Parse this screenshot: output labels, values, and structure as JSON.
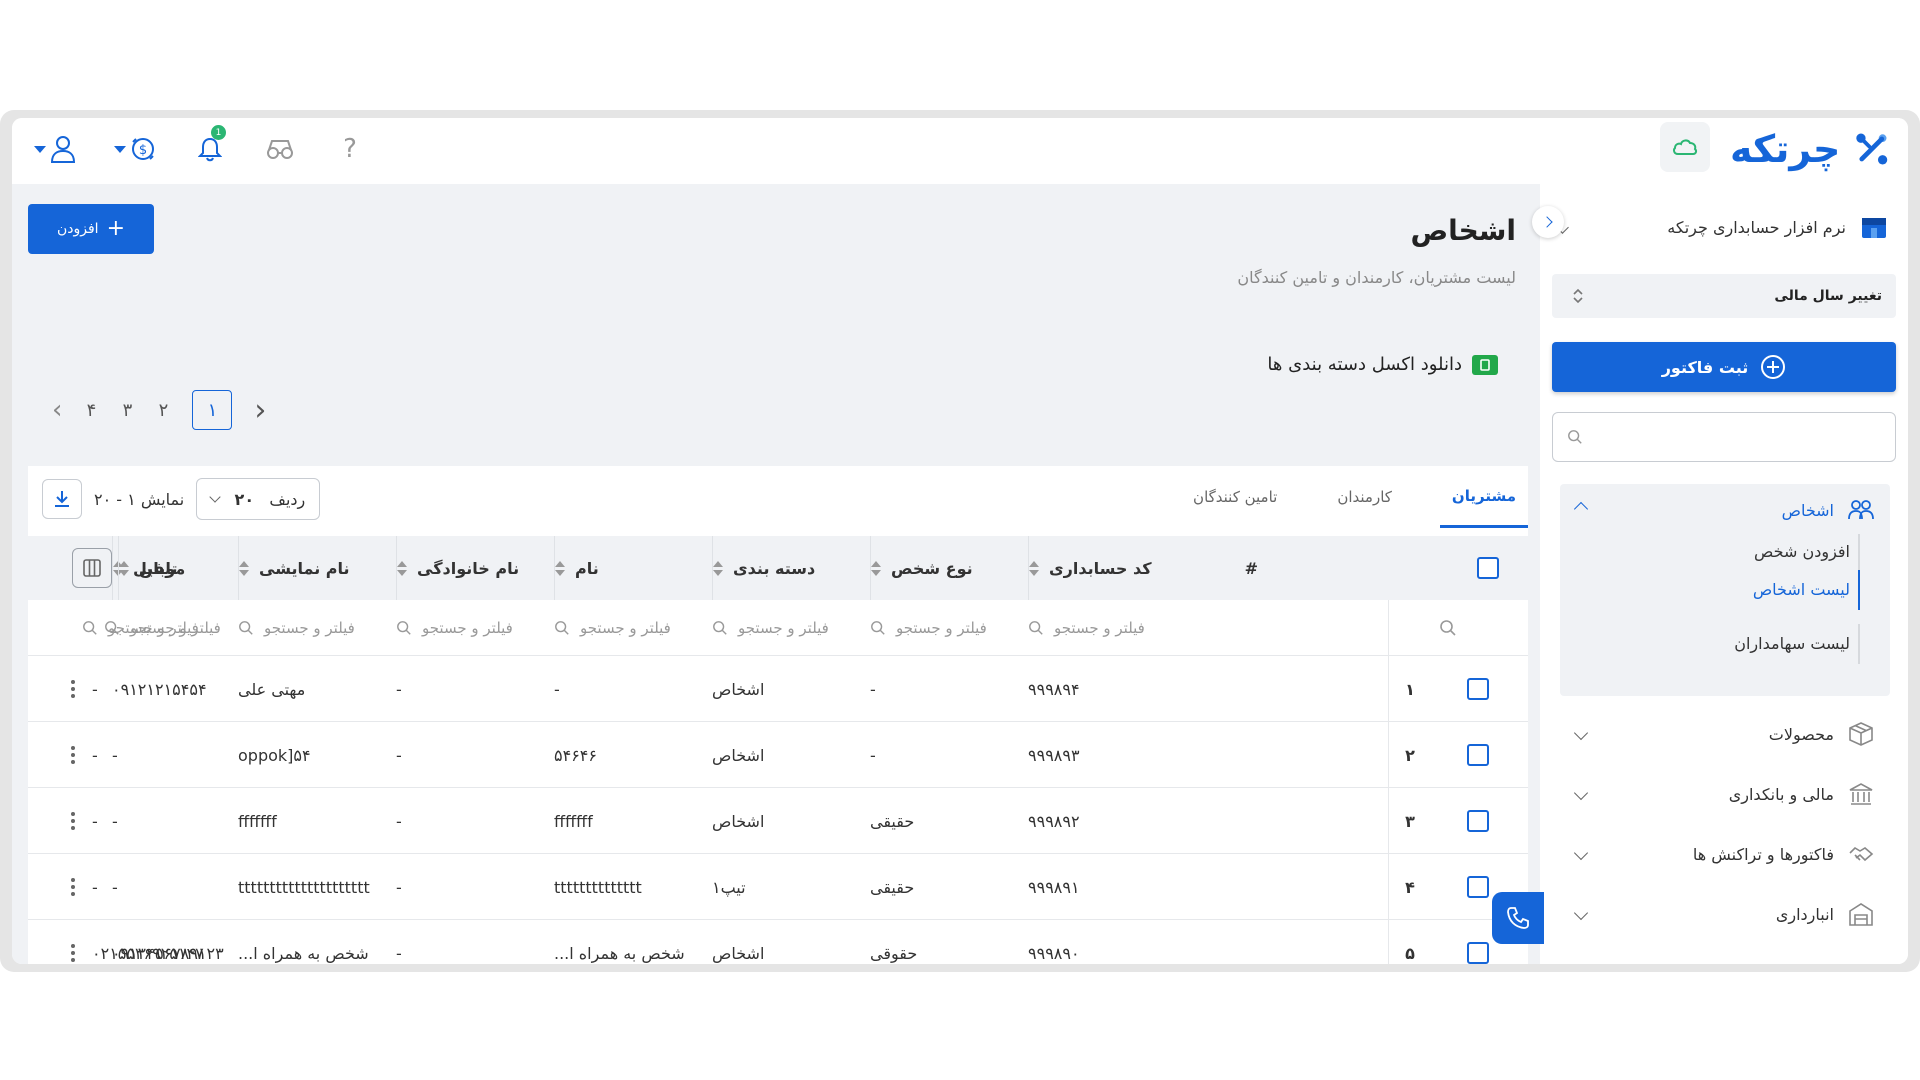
{
  "app": {
    "logo_text": "چرتکه",
    "brand_color": "#1565d8",
    "notification_count": "1"
  },
  "header": {
    "icons": [
      "user-icon",
      "coin-icon",
      "bell-icon",
      "glasses-icon",
      "help-icon",
      "cloud-icon"
    ],
    "help_label": "?"
  },
  "page": {
    "title": "اشخاص",
    "subtitle": "لیست مشتریان، کارمندان و تامین کنندگان",
    "add_button": "افزودن",
    "excel_link": "دانلود اکسل دسته بندی ها"
  },
  "pagination": {
    "pages": [
      "۱",
      "۲",
      "۳",
      "۴"
    ],
    "active": "۱"
  },
  "tabs": [
    {
      "label": "مشتریان",
      "active": true
    },
    {
      "label": "کارمندان",
      "active": false
    },
    {
      "label": "تامین کنندگان",
      "active": false
    }
  ],
  "table_tools": {
    "row_label": "ردیف",
    "row_count": "۲۰",
    "show_range": "نمایش ۱ - ۲۰"
  },
  "columns": [
    "#",
    "کد حسابداری",
    "نوع شخص",
    "دسته بندی",
    "نام",
    "نام خانوادگی",
    "نام نمایشی",
    "موبایل",
    "تلفن"
  ],
  "filter_placeholder": "فیلتر و جستجو",
  "rows": [
    {
      "num": "۱",
      "code": "۹۹۹۸۹۴",
      "type": "-",
      "category": "اشخاص",
      "name": "-",
      "family": "-",
      "display": "مهتی علی",
      "mobile": "۰۹۱۲۱۲۱۵۴۵۴",
      "phone": "-"
    },
    {
      "num": "۲",
      "code": "۹۹۹۸۹۳",
      "type": "-",
      "category": "اشخاص",
      "name": "۵۴۶۴۶",
      "family": "-",
      "display": "oppok]۵۴",
      "mobile": "-",
      "phone": "-"
    },
    {
      "num": "۳",
      "code": "۹۹۹۸۹۲",
      "type": "حقیقی",
      "category": "اشخاص",
      "name": "fffffff",
      "family": "-",
      "display": "fffffff",
      "mobile": "-",
      "phone": "-"
    },
    {
      "num": "۴",
      "code": "۹۹۹۸۹۱",
      "type": "حقیقی",
      "category": "تیپ۱",
      "name": "tttttttttttttt",
      "family": "-",
      "display": "ttttttttttttttttttttt",
      "mobile": "-",
      "phone": "-"
    },
    {
      "num": "۵",
      "code": "۹۹۹۸۹۰",
      "type": "حقوقی",
      "category": "اشخاص",
      "name": "شخص به همراه ا...",
      "family": "-",
      "display": "شخص به همراه ا...",
      "mobile": "۰۹۱۲۴۵۶۷۸۹۱۲۳",
      "phone": "۰۲۱۵۵۳۶۹۲۵۱۴۷"
    }
  ],
  "sidebar": {
    "org_name": "نرم افزار حسابداری چرتکه",
    "fiscal_year": "تغییر سال مالی",
    "invoice_button": "ثبت فاکتور",
    "search_placeholder": "",
    "group": {
      "label": "اشخاص",
      "items": [
        {
          "label": "افزودن شخص",
          "active": false
        },
        {
          "label": "لیست اشخاص",
          "active": true
        },
        {
          "label": "لیست سهامداران",
          "active": false
        }
      ]
    },
    "items": [
      {
        "label": "محصولات",
        "icon": "box-icon"
      },
      {
        "label": "مالی و بانکداری",
        "icon": "bank-icon"
      },
      {
        "label": "فاکتورها و تراکنش ها",
        "icon": "handshake-icon"
      },
      {
        "label": "انبارداری",
        "icon": "warehouse-icon"
      }
    ]
  }
}
